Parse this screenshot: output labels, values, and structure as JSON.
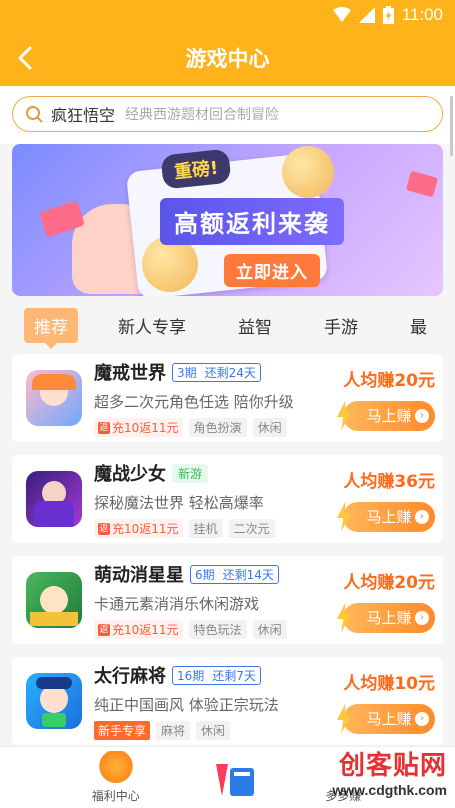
{
  "status_bar": {
    "time": "11:00"
  },
  "header": {
    "title": "游戏中心"
  },
  "search": {
    "query": "疯狂悟空",
    "placeholder": "经典西游题材回合制冒险"
  },
  "banner": {
    "badge": "重磅!",
    "headline": "高额返利来袭",
    "cta": "立即进入"
  },
  "tabs": [
    {
      "label": "推荐",
      "active": true
    },
    {
      "label": "新人专享"
    },
    {
      "label": "益智"
    },
    {
      "label": "手游"
    },
    {
      "label": "最"
    }
  ],
  "games": [
    {
      "name": "魔戒世界",
      "period": "3期",
      "remaining": "还剩24天",
      "desc": "超多二次元角色任选 陪你升级",
      "rebate": "充10返11元",
      "tags": [
        "角色扮演",
        "休闲"
      ],
      "earn": "人均赚20元",
      "button": "马上赚"
    },
    {
      "name": "魔战少女",
      "badge": "新游",
      "desc": "探秘魔法世界 轻松高爆率",
      "rebate": "充10返11元",
      "tags": [
        "挂机",
        "二次元"
      ],
      "earn": "人均赚36元",
      "button": "马上赚"
    },
    {
      "name": "萌动消星星",
      "period": "6期",
      "remaining": "还剩14天",
      "desc": "卡通元素消消乐休闲游戏",
      "rebate": "充10返11元",
      "tags": [
        "特色玩法",
        "休闲"
      ],
      "earn": "人均赚20元",
      "button": "马上赚"
    },
    {
      "name": "太行麻将",
      "period": "16期",
      "remaining": "还剩7天",
      "desc": "纯正中国画风 体验正宗玩法",
      "newtag": "新手专享",
      "tags": [
        "麻将",
        "休闲"
      ],
      "earn": "人均赚10元",
      "button": "马上赚"
    }
  ],
  "bottom_nav": {
    "left_label": "福利中心",
    "right_label": "多多赚"
  },
  "watermark": {
    "title": "创客贴网",
    "url": "www.cdgthk.com"
  },
  "colors": {
    "primary": "#ffb31a",
    "accent": "#ff6a1a",
    "link": "#3a78e8"
  }
}
